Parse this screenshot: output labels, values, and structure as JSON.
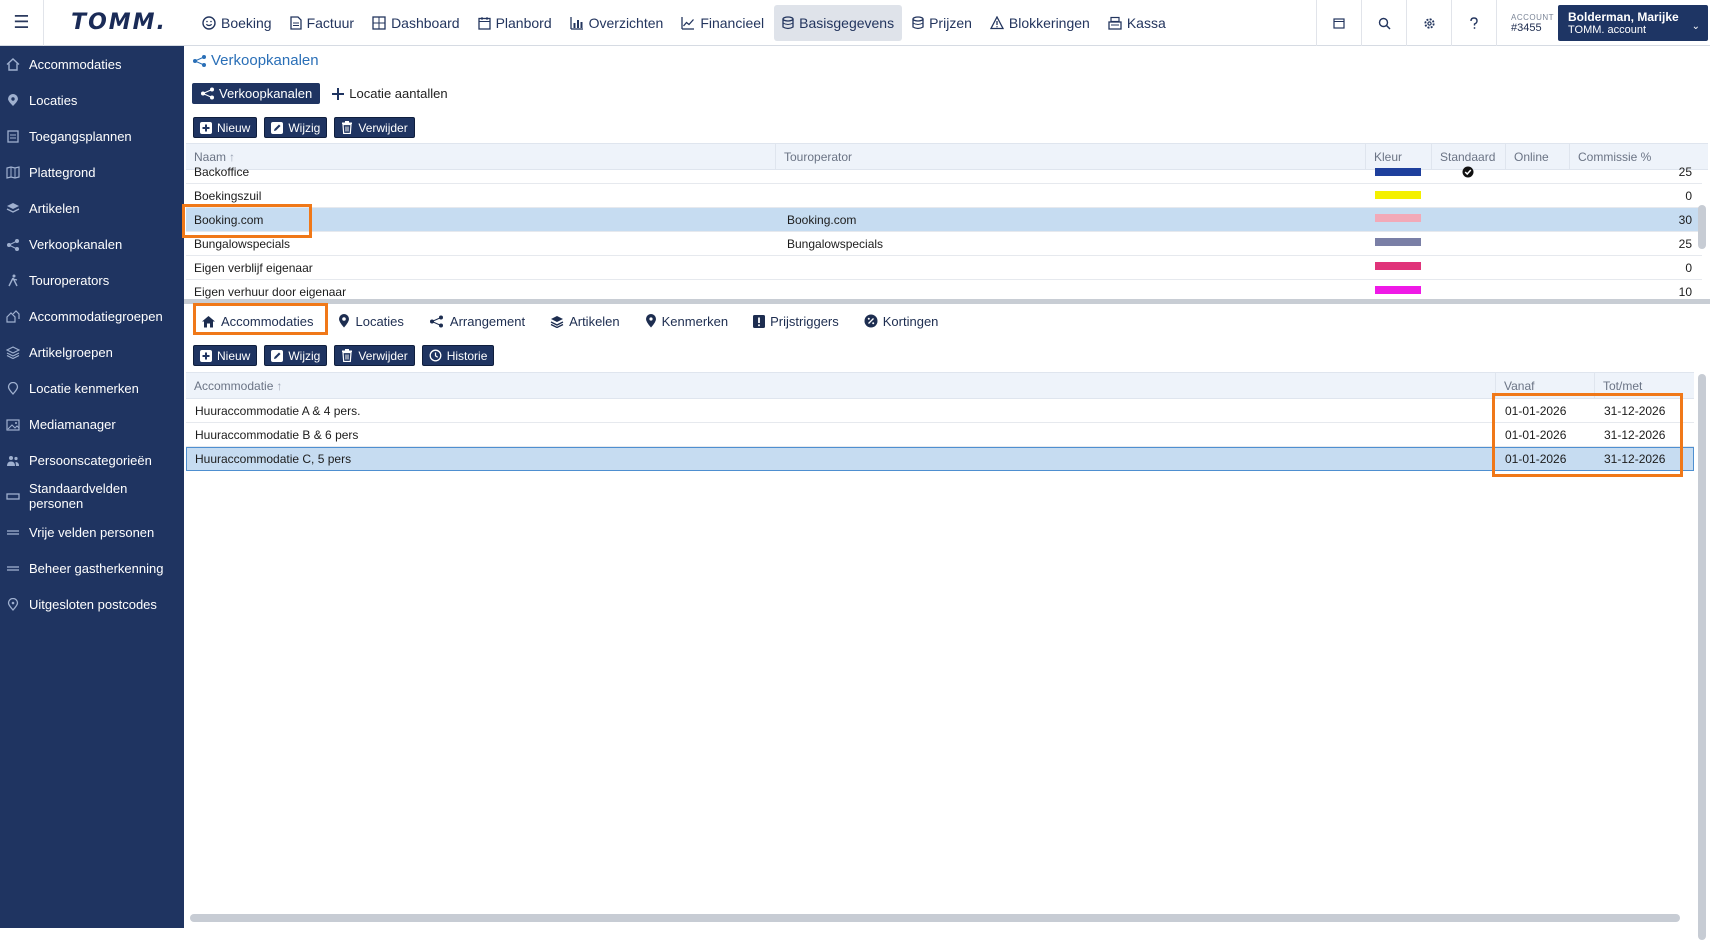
{
  "topbar": {
    "logo": "TOMM.",
    "nav": [
      {
        "label": "Boeking",
        "icon": "smiley-icon"
      },
      {
        "label": "Factuur",
        "icon": "document-icon"
      },
      {
        "label": "Dashboard",
        "icon": "grid-icon"
      },
      {
        "label": "Planbord",
        "icon": "calendar-icon"
      },
      {
        "label": "Overzichten",
        "icon": "bar-chart-icon"
      },
      {
        "label": "Financieel",
        "icon": "line-chart-icon"
      },
      {
        "label": "Basisgegevens",
        "icon": "database-icon",
        "active": true
      },
      {
        "label": "Prijzen",
        "icon": "database-icon"
      },
      {
        "label": "Blokkeringen",
        "icon": "warning-icon"
      },
      {
        "label": "Kassa",
        "icon": "register-icon"
      }
    ],
    "account_label": "ACCOUNT",
    "account_number": "#3455",
    "user_name": "Bolderman, Marijke",
    "user_sub": "TOMM. account"
  },
  "sidebar": {
    "items": [
      {
        "label": "Accommodaties"
      },
      {
        "label": "Locaties"
      },
      {
        "label": "Toegangsplannen"
      },
      {
        "label": "Plattegrond"
      },
      {
        "label": "Artikelen"
      },
      {
        "label": "Verkoopkanalen"
      },
      {
        "label": "Touroperators"
      },
      {
        "label": "Accommodatiegroepen"
      },
      {
        "label": "Artikelgroepen"
      },
      {
        "label": "Locatie kenmerken"
      },
      {
        "label": "Mediamanager"
      },
      {
        "label": "Persoonscategorieën"
      },
      {
        "label": "Standaardvelden personen"
      },
      {
        "label": "Vrije velden personen"
      },
      {
        "label": "Beheer gastherkenning"
      },
      {
        "label": "Uitgesloten postcodes"
      }
    ]
  },
  "page": {
    "title": "Verkoopkanalen",
    "tab_active": "Verkoopkanalen",
    "tab_other": "Locatie aantallen"
  },
  "toolbar1": {
    "new": "Nieuw",
    "edit": "Wijzig",
    "delete": "Verwijder"
  },
  "grid1": {
    "columns": [
      "Naam",
      "Touroperator",
      "Kleur",
      "Standaard",
      "Online",
      "Commissie %"
    ],
    "rows": [
      {
        "naam": "Backoffice",
        "touroperator": "",
        "kleur": "#1e3f9c",
        "standaard": true,
        "commissie": "25"
      },
      {
        "naam": "Boekingszuil",
        "touroperator": "",
        "kleur": "#f4f000",
        "standaard": false,
        "commissie": "0"
      },
      {
        "naam": "Booking.com",
        "touroperator": "Booking.com",
        "kleur": "#f2a9b8",
        "standaard": false,
        "commissie": "30",
        "selected": true
      },
      {
        "naam": "Bungalowspecials",
        "touroperator": "Bungalowspecials",
        "kleur": "#7a7fa6",
        "standaard": false,
        "commissie": "25"
      },
      {
        "naam": "Eigen verblijf eigenaar",
        "touroperator": "",
        "kleur": "#e0337a",
        "standaard": false,
        "commissie": "0"
      },
      {
        "naam": "Eigen verhuur door eigenaar",
        "touroperator": "",
        "kleur": "#ef19e6",
        "standaard": false,
        "commissie": "10"
      }
    ]
  },
  "tabs2": [
    {
      "label": "Accommodaties",
      "icon": "house-icon"
    },
    {
      "label": "Locaties",
      "icon": "pin-icon"
    },
    {
      "label": "Arrangement",
      "icon": "network-icon"
    },
    {
      "label": "Artikelen",
      "icon": "layers-icon"
    },
    {
      "label": "Kenmerken",
      "icon": "marker-icon"
    },
    {
      "label": "Prijstriggers",
      "icon": "exclamation-icon"
    },
    {
      "label": "Kortingen",
      "icon": "discount-icon"
    }
  ],
  "toolbar2": {
    "new": "Nieuw",
    "edit": "Wijzig",
    "delete": "Verwijder",
    "history": "Historie"
  },
  "grid2": {
    "columns": [
      "Accommodatie",
      "Vanaf",
      "Tot/met"
    ],
    "rows": [
      {
        "accommodatie": "Huuraccommodatie A & 4 pers.",
        "vanaf": "01-01-2026",
        "totmet": "31-12-2026"
      },
      {
        "accommodatie": "Huuraccommodatie B & 6 pers",
        "vanaf": "01-01-2026",
        "totmet": "31-12-2026"
      },
      {
        "accommodatie": "Huuraccommodatie C, 5 pers",
        "vanaf": "01-01-2026",
        "totmet": "31-12-2026",
        "selected": true
      }
    ]
  },
  "colors": {
    "brand_navy": "#1f3461",
    "accent_blue": "#2a6fb7",
    "selection": "#c6dcf1",
    "highlight_orange": "#f07818"
  }
}
